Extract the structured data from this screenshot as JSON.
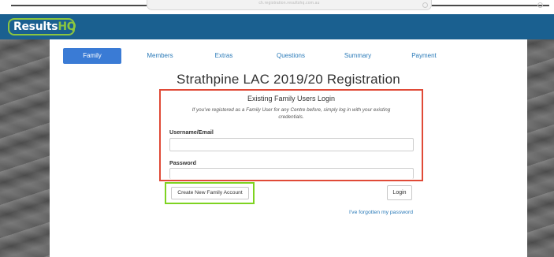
{
  "browser": {
    "url": "ch.registration.resultshq.com.au"
  },
  "header": {
    "brand_primary": "Results",
    "brand_accent": "HQ",
    "brand_color": "#1a6090",
    "accent_color": "#8cc63f"
  },
  "steps": [
    {
      "label": "Family",
      "active": true
    },
    {
      "label": "Members",
      "active": false
    },
    {
      "label": "Extras",
      "active": false
    },
    {
      "label": "Questions",
      "active": false
    },
    {
      "label": "Summary",
      "active": false
    },
    {
      "label": "Payment",
      "active": false
    }
  ],
  "page_title": "Strathpine LAC 2019/20 Registration",
  "login": {
    "heading": "Existing Family Users Login",
    "hint": "If you've registered as a Family User for any Centre before, simply log in with your existing credentials.",
    "username_label": "Username/Email",
    "username_value": "",
    "password_label": "Password",
    "password_value": "",
    "highlight_color": "#e04a37"
  },
  "actions": {
    "create_account_label": "Create New Family Account",
    "create_highlight_color": "#7ed321",
    "login_label": "Login",
    "forgot_password_label": "I've forgotten my password"
  }
}
